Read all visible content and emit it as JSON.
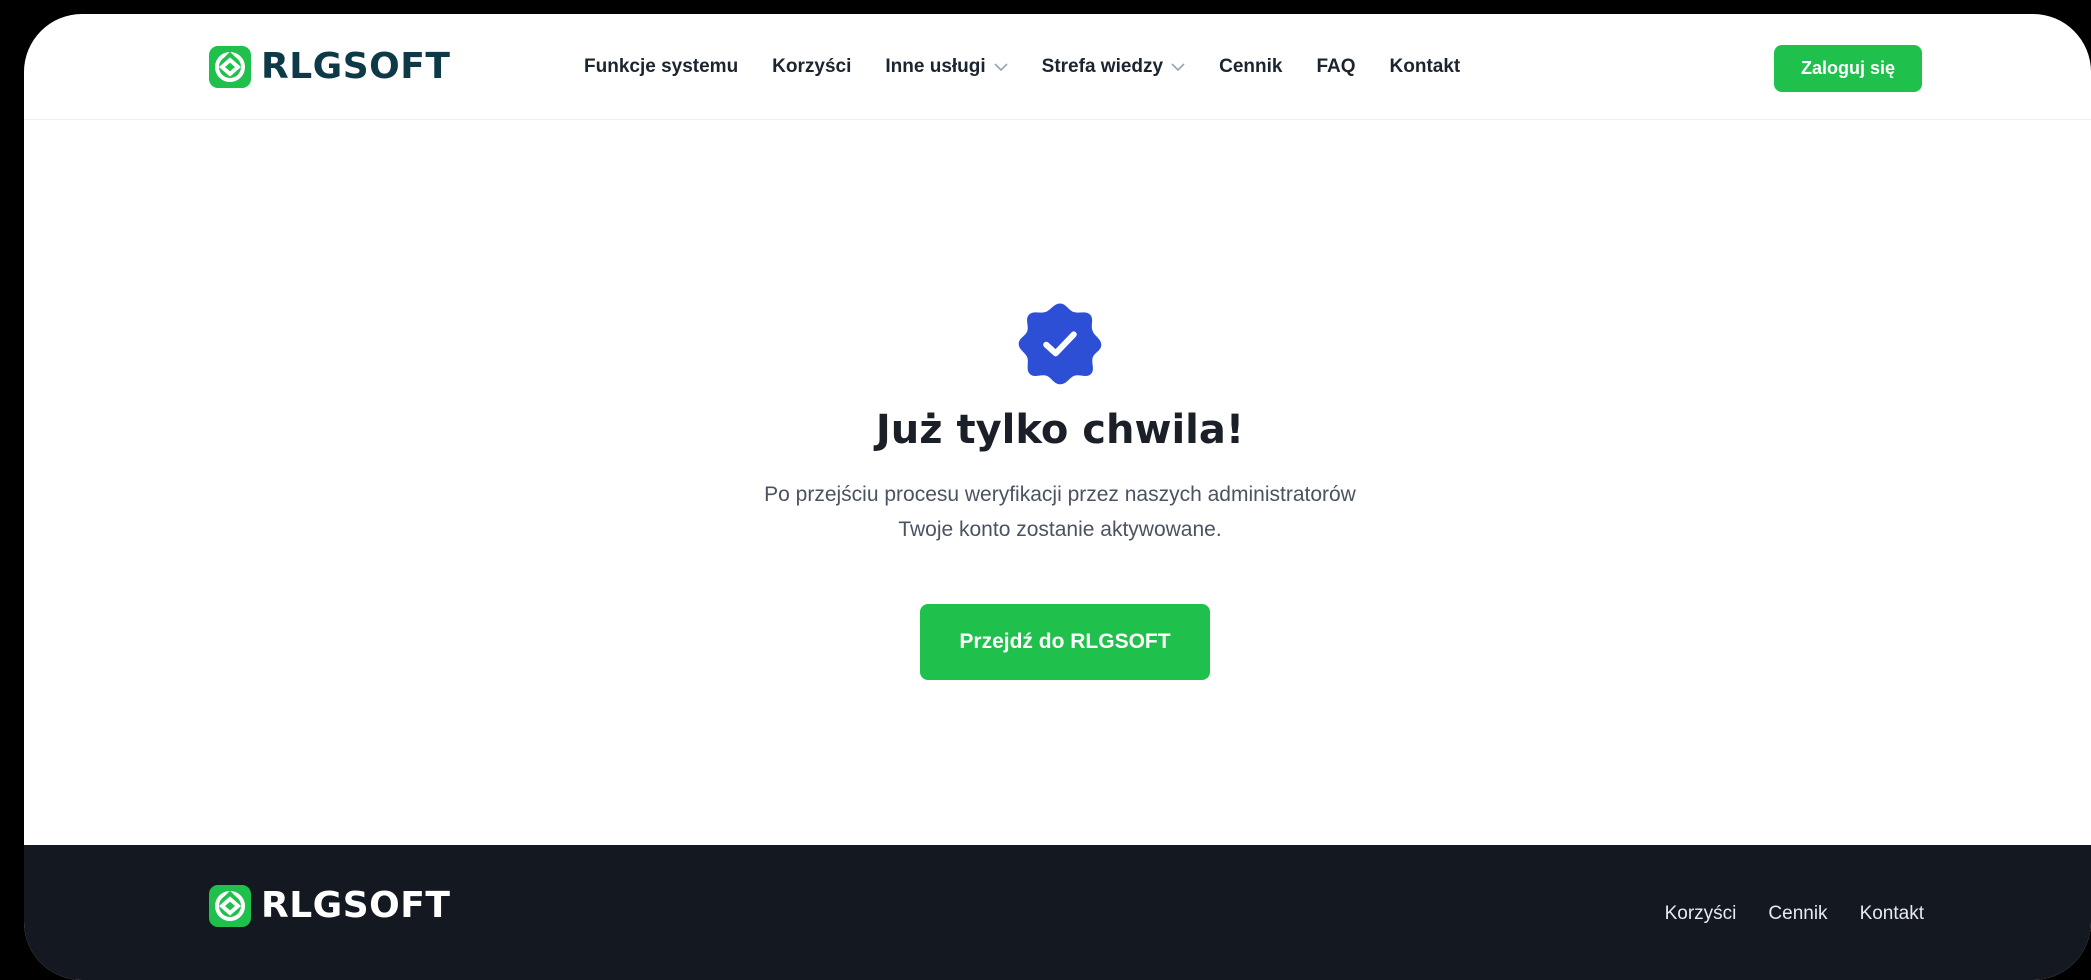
{
  "brand": {
    "name": "RLGSOFT",
    "accent": "#1fc04b",
    "dark": "#0e3a47"
  },
  "header": {
    "nav": [
      {
        "label": "Funkcje systemu",
        "dropdown": false
      },
      {
        "label": "Korzyści",
        "dropdown": false
      },
      {
        "label": "Inne usługi",
        "dropdown": true
      },
      {
        "label": "Strefa wiedzy",
        "dropdown": true
      },
      {
        "label": "Cennik",
        "dropdown": false
      },
      {
        "label": "FAQ",
        "dropdown": false
      },
      {
        "label": "Kontakt",
        "dropdown": false
      }
    ],
    "login_label": "Zaloguj się"
  },
  "main": {
    "icon": "verified-check-badge-icon",
    "icon_color": "#2d4fd6",
    "title": "Już tylko chwila!",
    "description_line1": "Po przejściu procesu weryfikacji przez naszych administratorów",
    "description_line2": "Twoje konto zostanie aktywowane.",
    "cta_label": "Przejdź do RLGSOFT"
  },
  "footer": {
    "links": [
      "Korzyści",
      "Cennik",
      "Kontakt"
    ]
  }
}
